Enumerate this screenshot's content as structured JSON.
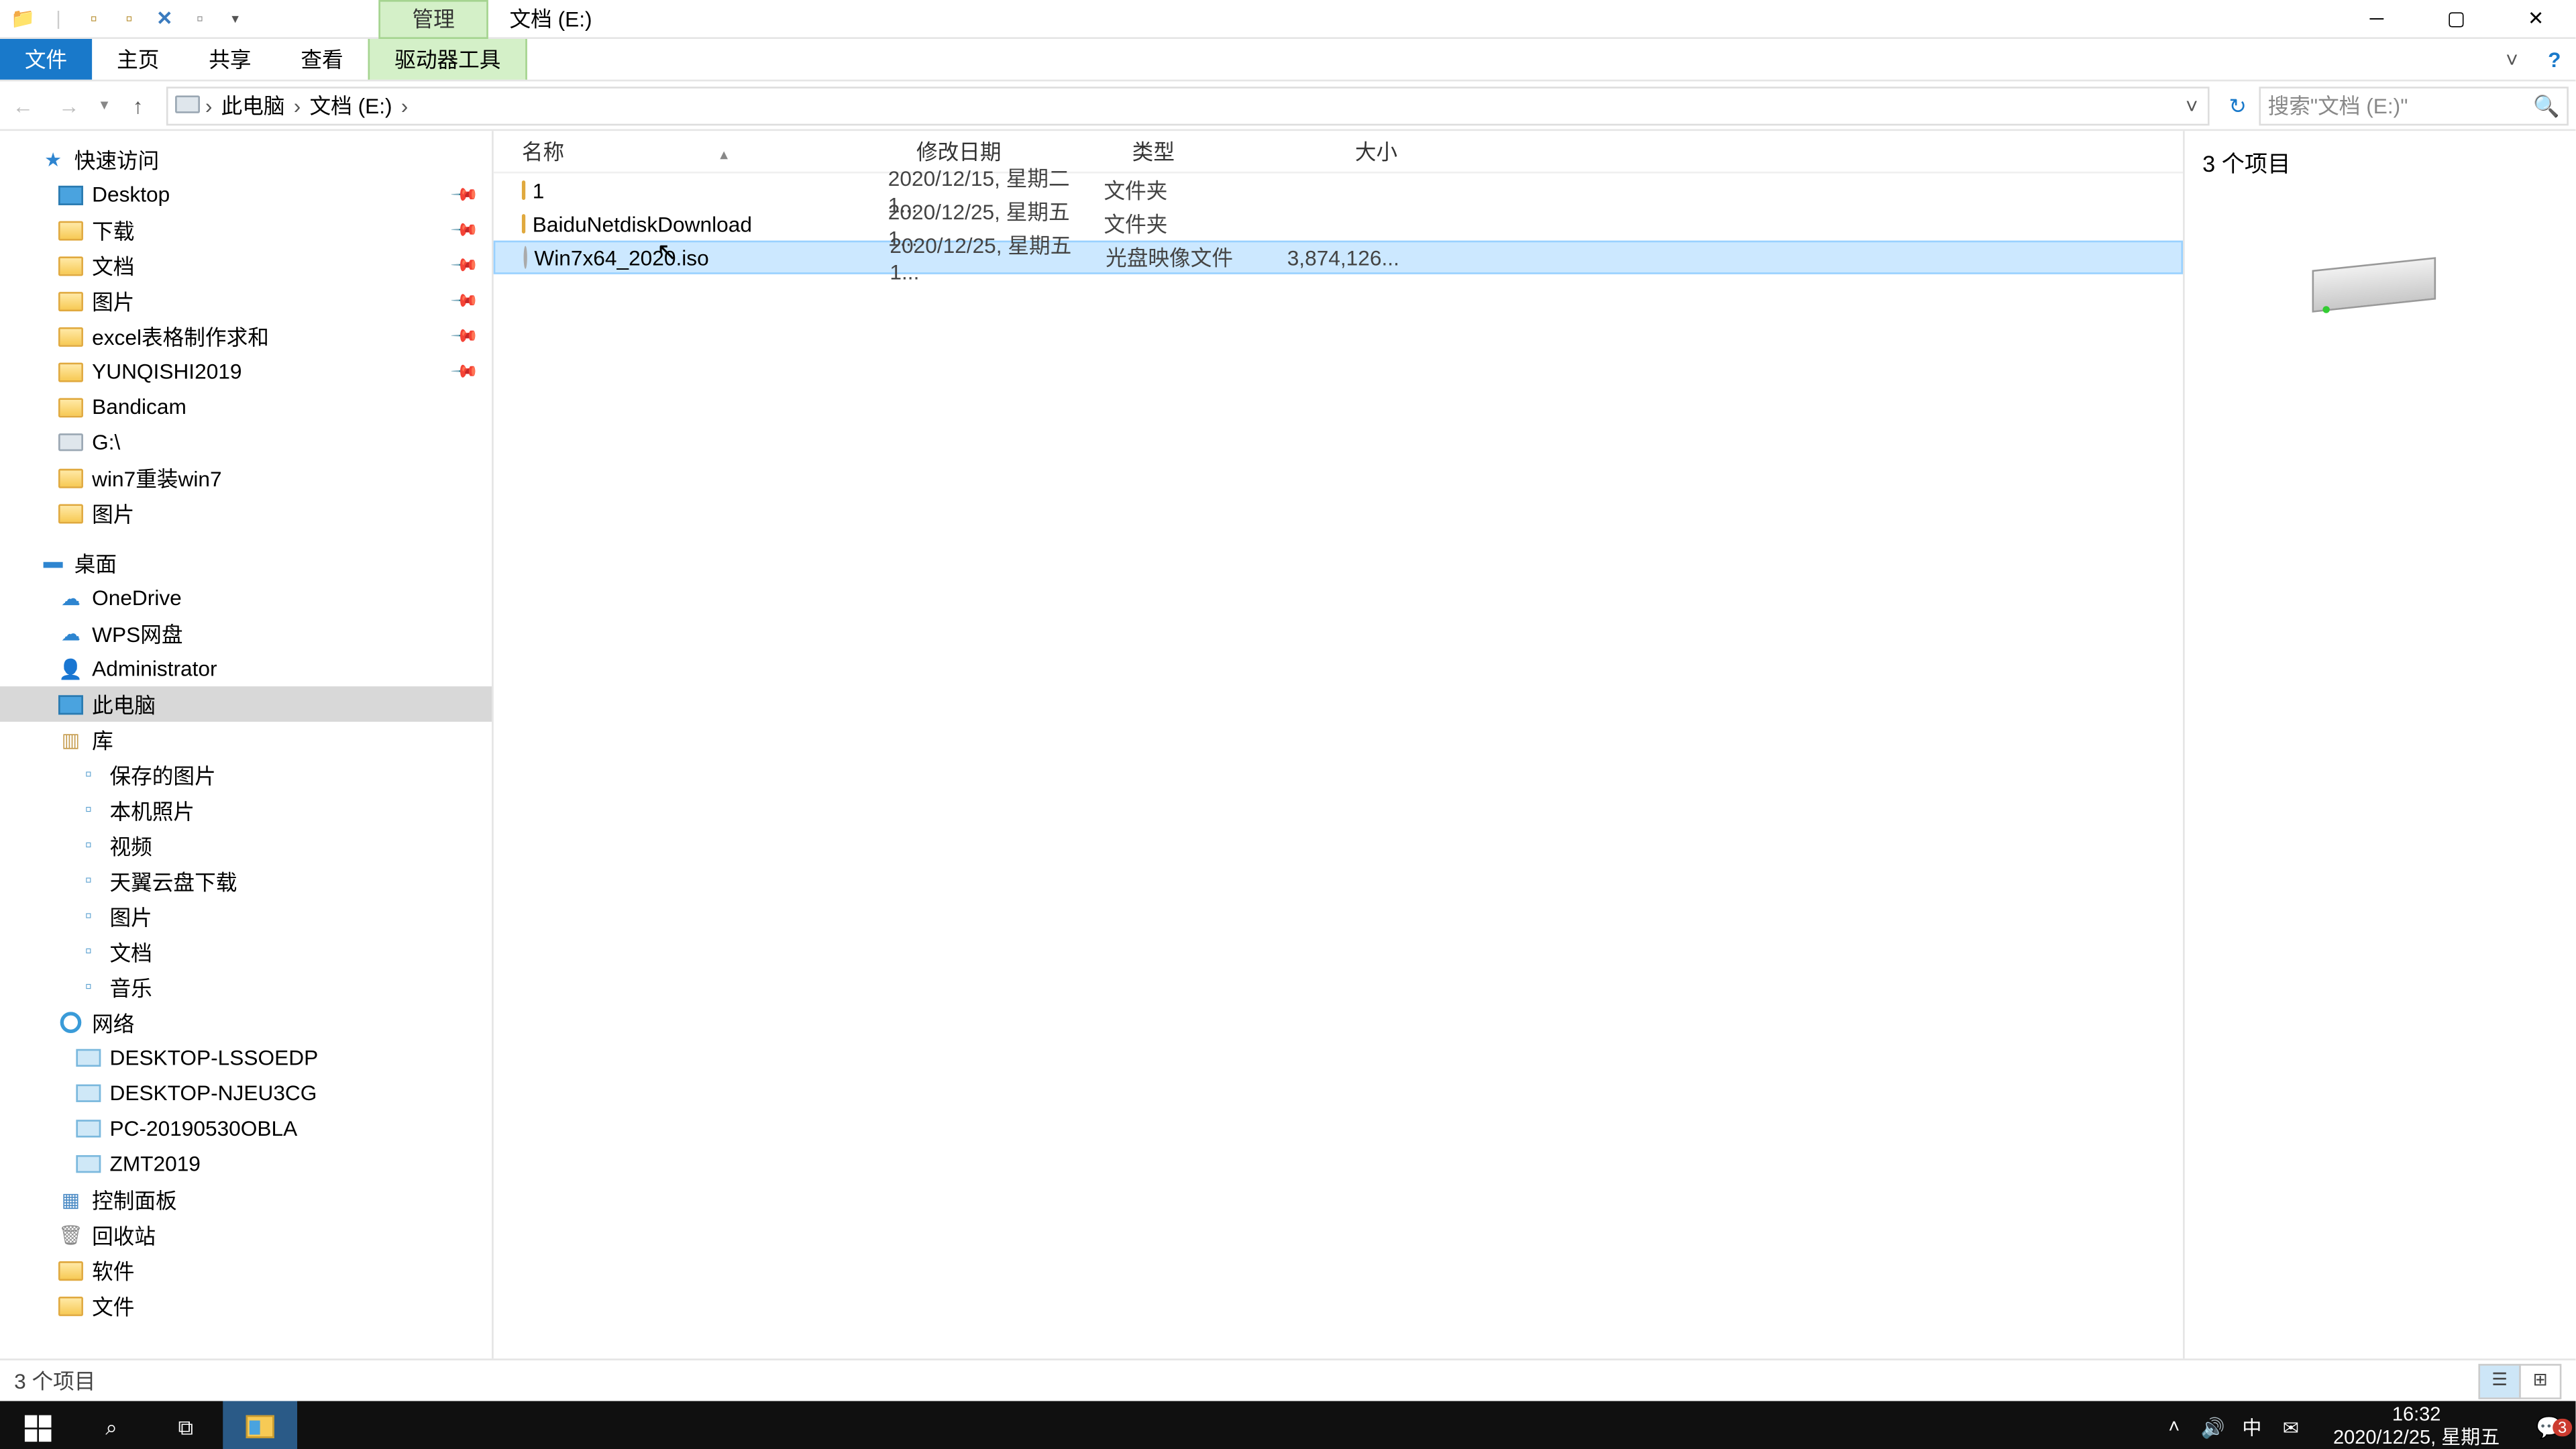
{
  "title": {
    "context_tab": "管理",
    "window": "文档 (E:)"
  },
  "ribbon": {
    "file": "文件",
    "home": "主页",
    "share": "共享",
    "view": "查看",
    "drive_tools": "驱动器工具"
  },
  "addr": {
    "segments": [
      "此电脑",
      "文档 (E:)"
    ],
    "search_placeholder": "搜索\"文档 (E:)\""
  },
  "tree": {
    "quick_access": "快速访问",
    "qa_items": [
      {
        "label": "Desktop",
        "icon": "pc"
      },
      {
        "label": "下载",
        "icon": "fld"
      },
      {
        "label": "文档",
        "icon": "fld"
      },
      {
        "label": "图片",
        "icon": "fld"
      },
      {
        "label": "excel表格制作求和",
        "icon": "fld"
      },
      {
        "label": "YUNQISHI2019",
        "icon": "fld"
      },
      {
        "label": "Bandicam",
        "icon": "fld",
        "nopin": true
      },
      {
        "label": "G:\\",
        "icon": "drv",
        "nopin": true
      },
      {
        "label": "win7重装win7",
        "icon": "fld",
        "nopin": true
      },
      {
        "label": "图片",
        "icon": "fld",
        "nopin": true
      }
    ],
    "desktop": "桌面",
    "desk_items": [
      {
        "label": "OneDrive",
        "icon": "cloud"
      },
      {
        "label": "WPS网盘",
        "icon": "cloud"
      },
      {
        "label": "Administrator",
        "icon": "user"
      },
      {
        "label": "此电脑",
        "icon": "pc",
        "sel": true
      },
      {
        "label": "库",
        "icon": "lib"
      }
    ],
    "lib_items": [
      {
        "label": "保存的图片"
      },
      {
        "label": "本机照片"
      },
      {
        "label": "视频"
      },
      {
        "label": "天翼云盘下载"
      },
      {
        "label": "图片"
      },
      {
        "label": "文档"
      },
      {
        "label": "音乐"
      }
    ],
    "network": "网络",
    "net_items": [
      {
        "label": "DESKTOP-LSSOEDP"
      },
      {
        "label": "DESKTOP-NJEU3CG"
      },
      {
        "label": "PC-20190530OBLA"
      },
      {
        "label": "ZMT2019"
      }
    ],
    "tail": [
      {
        "label": "控制面板",
        "icon": "cpl"
      },
      {
        "label": "回收站",
        "icon": "bin"
      },
      {
        "label": "软件",
        "icon": "fld"
      },
      {
        "label": "文件",
        "icon": "fld"
      }
    ]
  },
  "columns": {
    "name": "名称",
    "date": "修改日期",
    "type": "类型",
    "size": "大小"
  },
  "files": [
    {
      "name": "1",
      "date": "2020/12/15, 星期二 1...",
      "type": "文件夹",
      "size": "",
      "icon": "fld"
    },
    {
      "name": "BaiduNetdiskDownload",
      "date": "2020/12/25, 星期五 1...",
      "type": "文件夹",
      "size": "",
      "icon": "fld"
    },
    {
      "name": "Win7x64_2020.iso",
      "date": "2020/12/25, 星期五 1...",
      "type": "光盘映像文件",
      "size": "3,874,126...",
      "icon": "disc",
      "sel": true
    }
  ],
  "preview": {
    "count_label": "3 个项目"
  },
  "status": {
    "text": "3 个项目"
  },
  "taskbar": {
    "time": "16:32",
    "date": "2020/12/25, 星期五",
    "ime": "中",
    "notif_count": "3"
  }
}
